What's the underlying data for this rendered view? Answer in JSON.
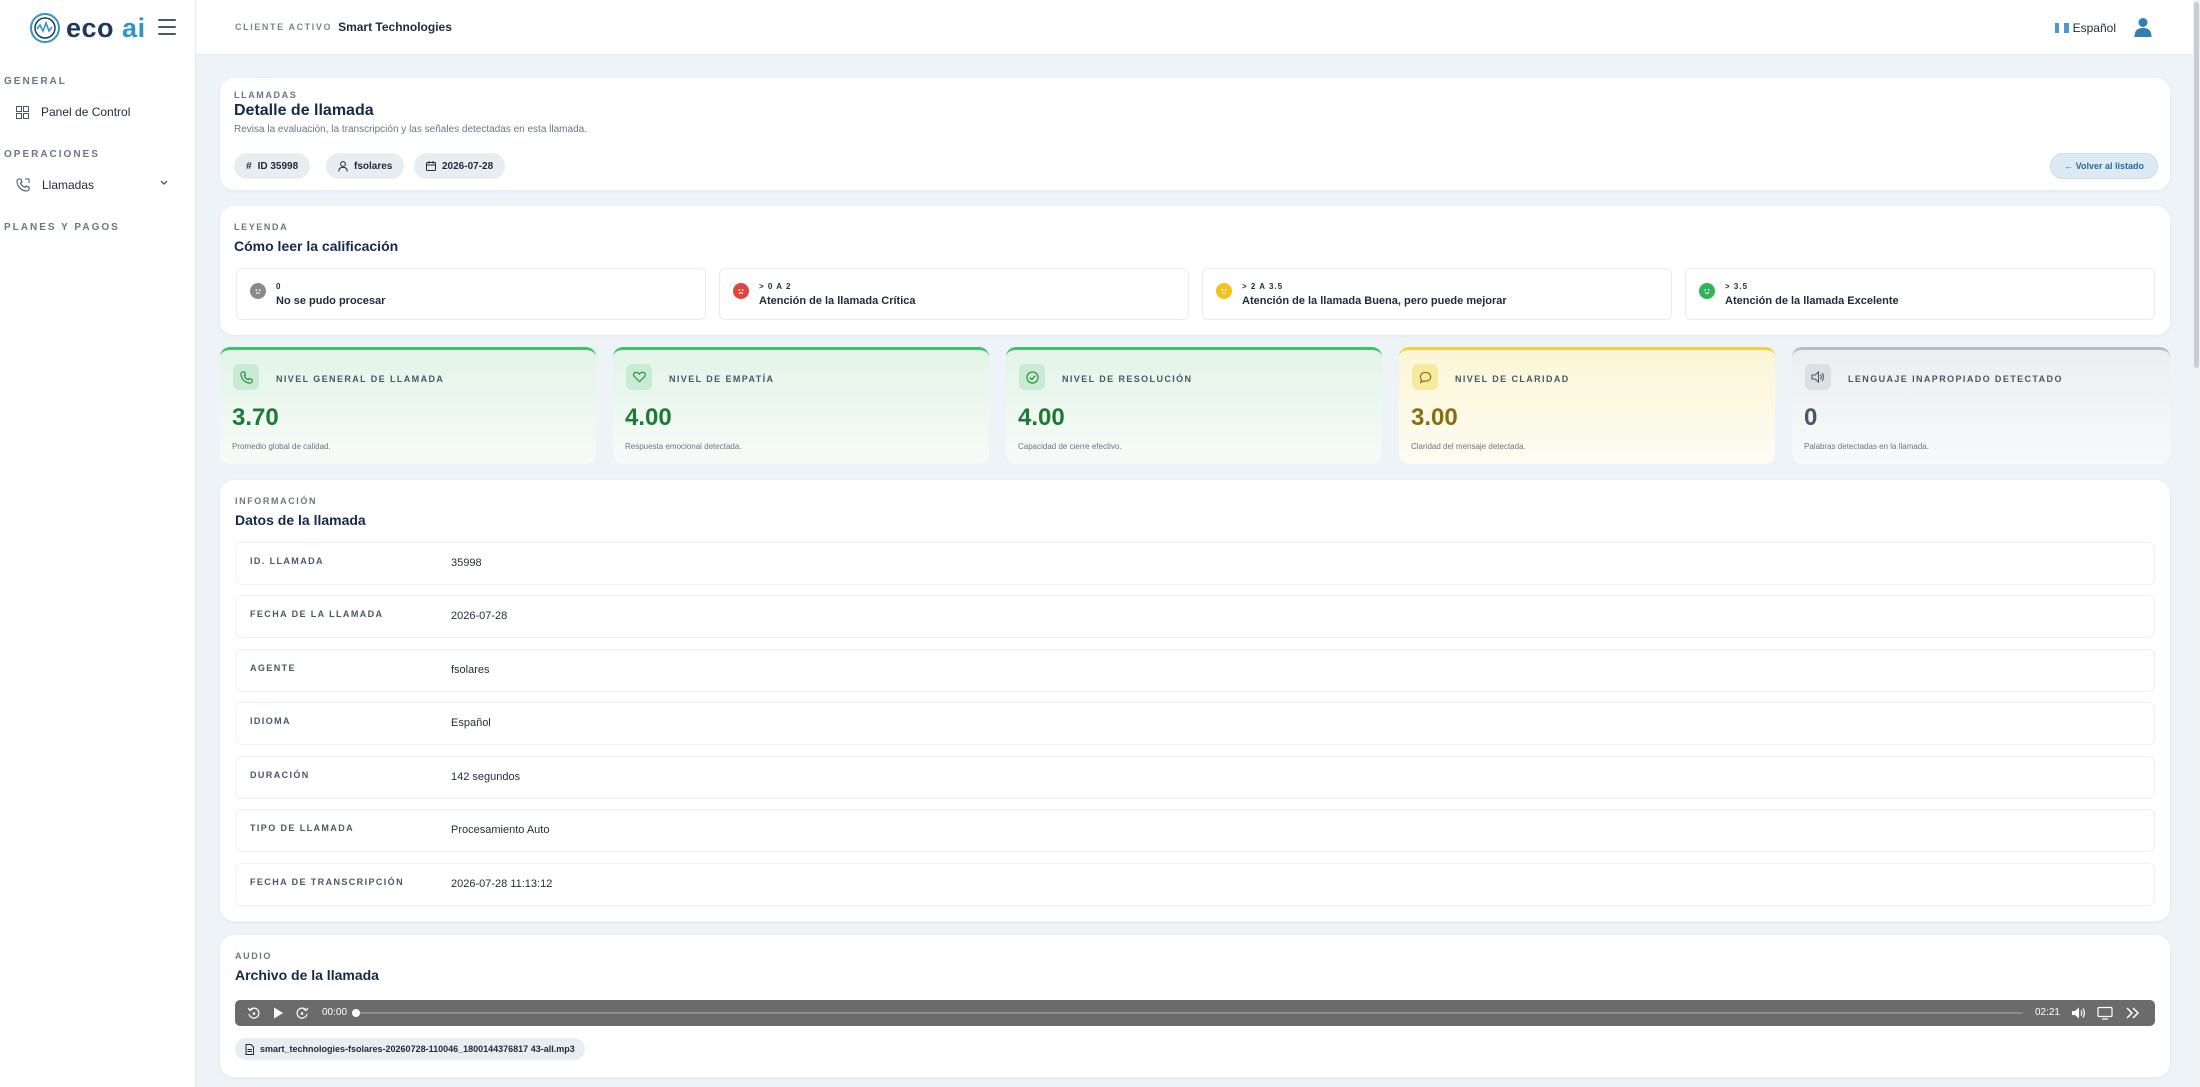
{
  "brand": {
    "logo_eco": "eco",
    "logo_ai": "ai"
  },
  "sidebar": {
    "sections": [
      {
        "title": "GENERAL",
        "items": [
          {
            "label": "Panel de Control",
            "icon": "grid-icon"
          }
        ]
      },
      {
        "title": "OPERACIONES",
        "items": [
          {
            "label": "Llamadas",
            "icon": "phone-icon"
          }
        ]
      },
      {
        "title": "PLANES Y PAGOS",
        "items": []
      }
    ]
  },
  "topbar": {
    "client_label": "CLIENTE ACTIVO",
    "client_name": "Smart Technologies",
    "language": "Español"
  },
  "header": {
    "eyebrow": "LLAMADAS",
    "title": "Detalle de llamada",
    "subtitle": "Revisa la evaluación, la transcripción y las señales detectadas en esta llamada.",
    "chips": {
      "id": "ID 35998",
      "agent": "fsolares",
      "date": "2026-07-28"
    },
    "back_label": "← Volver al listado"
  },
  "legend": {
    "eyebrow": "LEYENDA",
    "title": "Cómo leer la calificación",
    "items": [
      {
        "range": "0",
        "text": "No se pudo procesar",
        "color": "#8a8a8a"
      },
      {
        "range": "> 0 A 2",
        "text": "Atención de la llamada Crítica",
        "color": "#e0443c"
      },
      {
        "range": "> 2 A 3.5",
        "text": "Atención de la llamada Buena, pero puede mejorar",
        "color": "#f2c31b"
      },
      {
        "range": "> 3.5",
        "text": "Atención de la llamada Excelente",
        "color": "#2fb45a"
      }
    ]
  },
  "metrics": [
    {
      "label": "NIVEL GENERAL DE LLAMADA",
      "value": "3.70",
      "desc": "Promedio global de calidad.",
      "color": "#1d7a34"
    },
    {
      "label": "NIVEL DE EMPATÍA",
      "value": "4.00",
      "desc": "Respuesta emocional detectada.",
      "color": "#1d7a34"
    },
    {
      "label": "NIVEL DE RESOLUCIÓN",
      "value": "4.00",
      "desc": "Capacidad de cierre efectivo.",
      "color": "#1d7a34"
    },
    {
      "label": "NIVEL DE CLARIDAD",
      "value": "3.00",
      "desc": "Claridad del mensaje detectada.",
      "color": "#8a6d0c"
    },
    {
      "label": "LENGUAJE INAPROPIADO DETECTADO",
      "value": "0",
      "desc": "Palabras detectadas en la llamada.",
      "color": "#4a5766"
    }
  ],
  "info": {
    "eyebrow": "INFORMACIÓN",
    "title": "Datos de la llamada",
    "rows": [
      {
        "key": "ID. LLAMADA",
        "value": "35998"
      },
      {
        "key": "FECHA DE LA LLAMADA",
        "value": "2026-07-28"
      },
      {
        "key": "AGENTE",
        "value": "fsolares"
      },
      {
        "key": "IDIOMA",
        "value": "Español"
      },
      {
        "key": "DURACIÓN",
        "value": "142 segundos"
      },
      {
        "key": "TIPO DE LLAMADA",
        "value": "Procesamiento Auto"
      },
      {
        "key": "FECHA DE TRANSCRIPCIÓN",
        "value": "2026-07-28 11:13:12"
      }
    ]
  },
  "audio": {
    "eyebrow": "AUDIO",
    "title": "Archivo de la llamada",
    "current_time": "00:00",
    "duration": "02:21",
    "progress": 0,
    "file_name": "smart_technologies-fsolares-20260728-110046_1800144376817 43-all.mp3"
  }
}
